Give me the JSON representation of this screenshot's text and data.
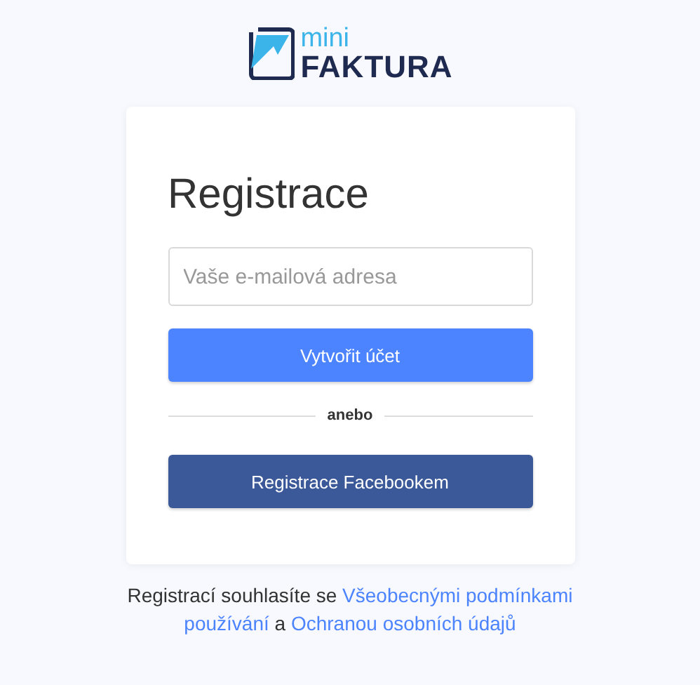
{
  "logo": {
    "small": "mini",
    "big": "FAKTURA"
  },
  "card": {
    "title": "Registrace",
    "email": {
      "placeholder": "Vaše e-mailová adresa"
    },
    "submit": "Vytvořit účet",
    "divider": "anebo",
    "facebook": "Registrace Facebookem"
  },
  "legal": {
    "prefix": "Registrací souhlasíte se",
    "terms_link": [
      "Všeobecnými podmínkami",
      "používání"
    ],
    "conjunction": "a",
    "privacy_link": "Ochranou osobních údajů"
  }
}
